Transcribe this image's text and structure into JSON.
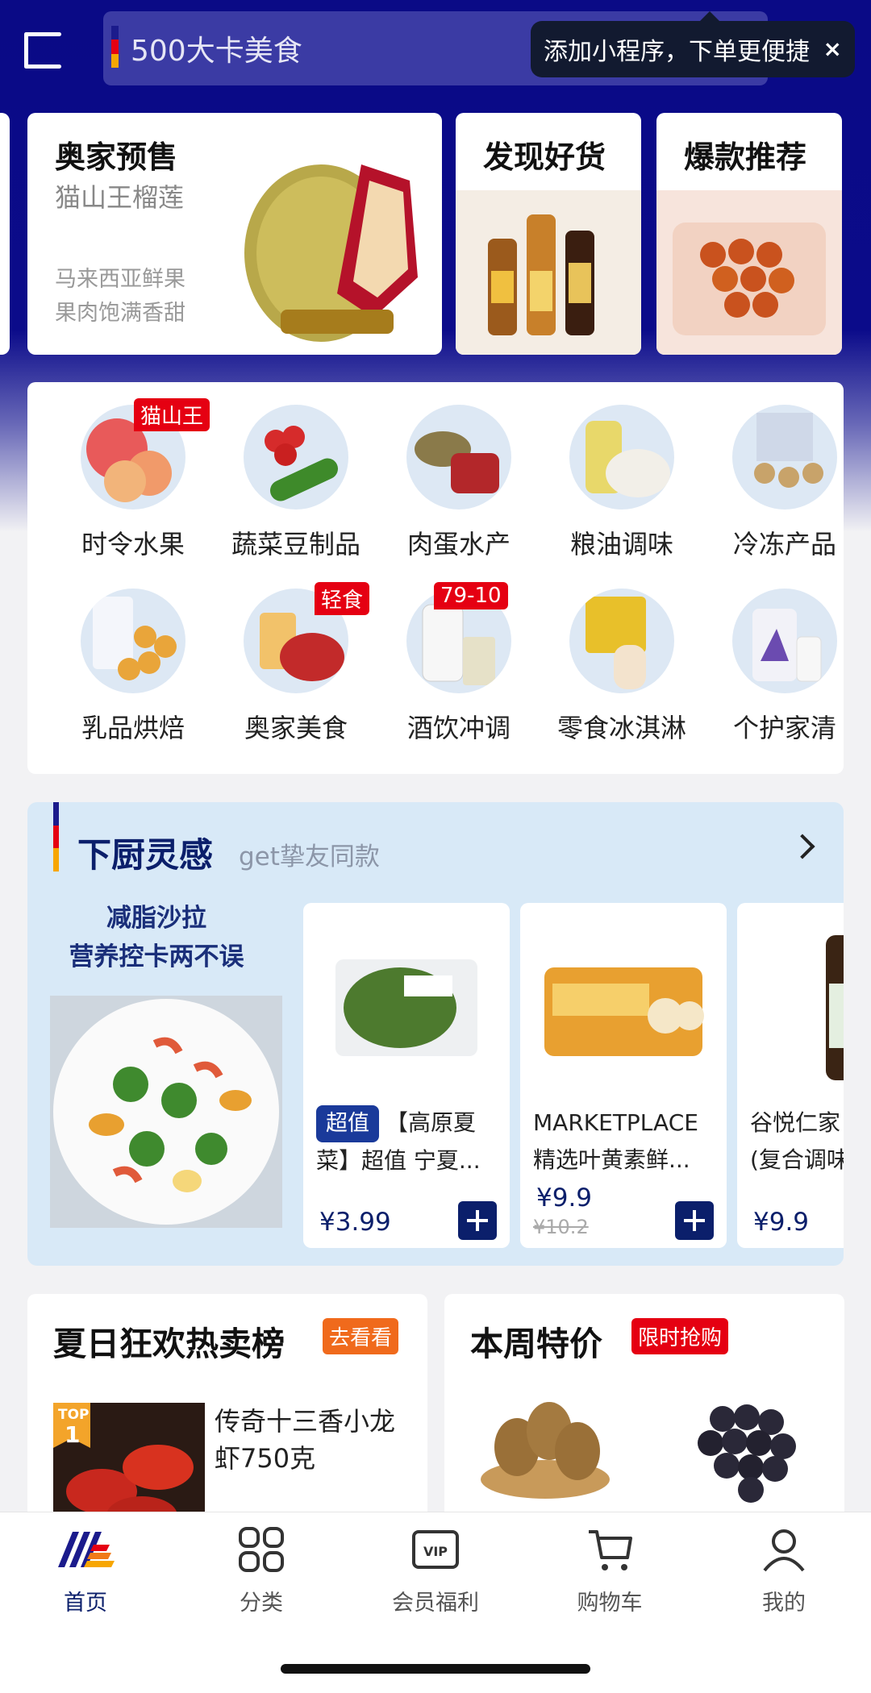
{
  "top": {
    "search_text": "500大卡美食",
    "tooltip_text": "添加小程序，下单更便捷",
    "tooltip_close": "×"
  },
  "promos": [
    {
      "title": "奥家预售",
      "subtitle": "猫山王榴莲",
      "desc1": "马来西亚鲜果",
      "desc2": "果肉饱满香甜"
    },
    {
      "title": "发现好货"
    },
    {
      "title": "爆款推荐"
    }
  ],
  "categories": [
    {
      "label": "时令水果",
      "badge": "猫山王"
    },
    {
      "label": "蔬菜豆制品"
    },
    {
      "label": "肉蛋水产"
    },
    {
      "label": "粮油调味"
    },
    {
      "label": "冷冻产品"
    },
    {
      "label": "乳品烘焙"
    },
    {
      "label": "奥家美食",
      "badge": "轻食"
    },
    {
      "label": "酒饮冲调",
      "badge": "79-10"
    },
    {
      "label": "零食冰淇淋"
    },
    {
      "label": "个护家清"
    }
  ],
  "inspiration": {
    "title": "下厨灵感",
    "subtitle": "get挚友同款",
    "feature_line1": "减脂沙拉",
    "feature_line2": "营养控卡两不误",
    "products": [
      {
        "tag": "超值",
        "name": "【高原夏菜】超值 宁夏...",
        "price": "¥3.99"
      },
      {
        "name_line1": "MARKETPLACE",
        "name_line2": "精选叶黄素鲜...",
        "price": "¥9.9",
        "original_price": "¥10.2"
      },
      {
        "name_line1": "谷悦仁家",
        "name_line2": "(复合调味",
        "price": "¥9.9"
      }
    ]
  },
  "hot": {
    "title": "夏日狂欢热卖榜",
    "tag": "去看看",
    "rank_top": "TOP",
    "rank_num": "1",
    "item_name": "传奇十三香小龙虾750克"
  },
  "weekly": {
    "title": "本周特价",
    "tag": "限时抢购"
  },
  "tabs": [
    "首页",
    "分类",
    "会员福利",
    "购物车",
    "我的"
  ],
  "colors": {
    "brand_navy": "#0b1f6b",
    "hero_blue": "#0a0a86",
    "badge_red": "#e50012",
    "accent_orange": "#f06a1c"
  }
}
